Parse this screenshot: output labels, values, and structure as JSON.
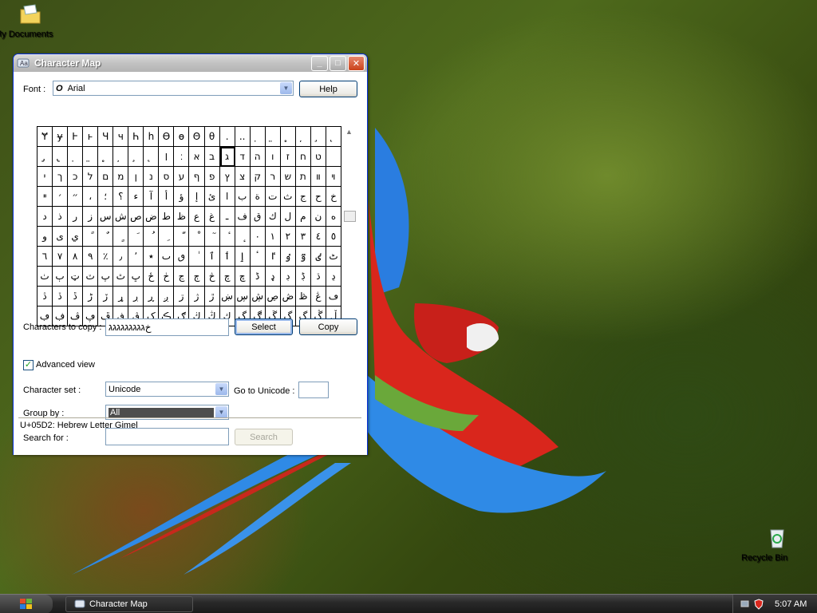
{
  "desktop": {
    "icons": [
      {
        "label": "My Documents"
      },
      {
        "label": "Recycle Bin"
      }
    ],
    "partial_label": "M"
  },
  "window": {
    "title": "Character Map",
    "font_label": "Font :",
    "font_value": "Arial",
    "help_label": "Help",
    "grid_rows": [
      [
        "Ɏ",
        "ɏ",
        "Ⱶ",
        "ⱶ",
        "Ч",
        "ч",
        "Һ",
        "һ",
        "Ɵ",
        "ɵ",
        "Θ",
        "θ",
        ".",
        "..",
        "̣",
        "̤",
        "̥",
        "̦",
        "̧",
        "̨"
      ],
      [
        "̡",
        "̢",
        "̣",
        "̤",
        "̥",
        "̦",
        "̧",
        "̨",
        "׀",
        "׃",
        "א",
        "ב",
        "ג",
        "ד",
        "ה",
        "ו",
        "ז",
        "ח",
        "ט",
        ""
      ],
      [
        "י",
        "ך",
        "כ",
        "ל",
        "ם",
        "מ",
        "ן",
        "נ",
        "ס",
        "ע",
        "ף",
        "פ",
        "ץ",
        "צ",
        "ק",
        "ר",
        "ש",
        "ת",
        "װ",
        "ױ"
      ],
      [
        "ײ",
        "׳",
        "״",
        "،",
        "؛",
        "؟",
        "ء",
        "آ",
        "أ",
        "ؤ",
        "إ",
        "ئ",
        "ا",
        "ب",
        "ة",
        "ت",
        "ث",
        "ج",
        "ح",
        "خ"
      ],
      [
        "د",
        "ذ",
        "ر",
        "ز",
        "س",
        "ش",
        "ص",
        "ض",
        "ط",
        "ظ",
        "ع",
        "غ",
        "ـ",
        "ف",
        "ق",
        "ك",
        "ل",
        "م",
        "ن",
        "ه"
      ],
      [
        "و",
        "ى",
        "ي",
        "ً",
        "ٌ",
        "ٍ",
        "َ",
        "ُ",
        "ِ",
        "ّ",
        "ْ",
        "ٓ",
        "ٔ",
        "ٕ",
        "٠",
        "١",
        "٢",
        "٣",
        "٤",
        "٥"
      ],
      [
        "٦",
        "٧",
        "٨",
        "٩",
        "٪",
        "٫",
        "٬",
        "٭",
        "ٮ",
        "ٯ",
        "ٰ",
        "ٱ",
        "ٲ",
        "ٳ",
        "ٴ",
        "ٵ",
        "ٶ",
        "ٷ",
        "ٸ",
        "ٹ"
      ],
      [
        "ٺ",
        "ٻ",
        "ټ",
        "ٽ",
        "پ",
        "ٿ",
        "ڀ",
        "ځ",
        "ڂ",
        "ڃ",
        "ڄ",
        "څ",
        "چ",
        "ڇ",
        "ڈ",
        "ډ",
        "ڊ",
        "ڋ",
        "ڌ",
        "ڍ"
      ],
      [
        "ڎ",
        "ڏ",
        "ڐ",
        "ڑ",
        "ڒ",
        "ړ",
        "ڔ",
        "ڕ",
        "ږ",
        "ڗ",
        "ژ",
        "ڙ",
        "ښ",
        "ڛ",
        "ڜ",
        "ڝ",
        "ڞ",
        "ڟ",
        "ڠ",
        "ڡ"
      ],
      [
        "ڢ",
        "ڣ",
        "ڤ",
        "ڥ",
        "ڦ",
        "ڧ",
        "ڨ",
        "ک",
        "ڪ",
        "ګ",
        "ڬ",
        "ڭ",
        "ڮ",
        "گ",
        "ڰ",
        "ڱ",
        "ڲ",
        "ڳ",
        "ڴ",
        "ڵ"
      ]
    ],
    "chars_to_copy_label": "Characters to copy :",
    "chars_to_copy_value": "ג‎ג‎ג‎ג‎ג‎ג‎ג‎ג‎ג‎خ",
    "select_label": "Select",
    "copy_label": "Copy",
    "advanced_view_label": "Advanced view",
    "character_set_label": "Character set :",
    "character_set_value": "Unicode",
    "goto_unicode_label": "Go to Unicode :",
    "goto_unicode_value": "",
    "group_by_label": "Group by :",
    "group_by_value": "All",
    "search_for_label": "Search for :",
    "search_value": "",
    "search_button_label": "Search",
    "status_text": "U+05D2: Hebrew Letter Gimel"
  },
  "taskbar": {
    "task_label": "Character Map",
    "clock": "5:07 AM"
  }
}
